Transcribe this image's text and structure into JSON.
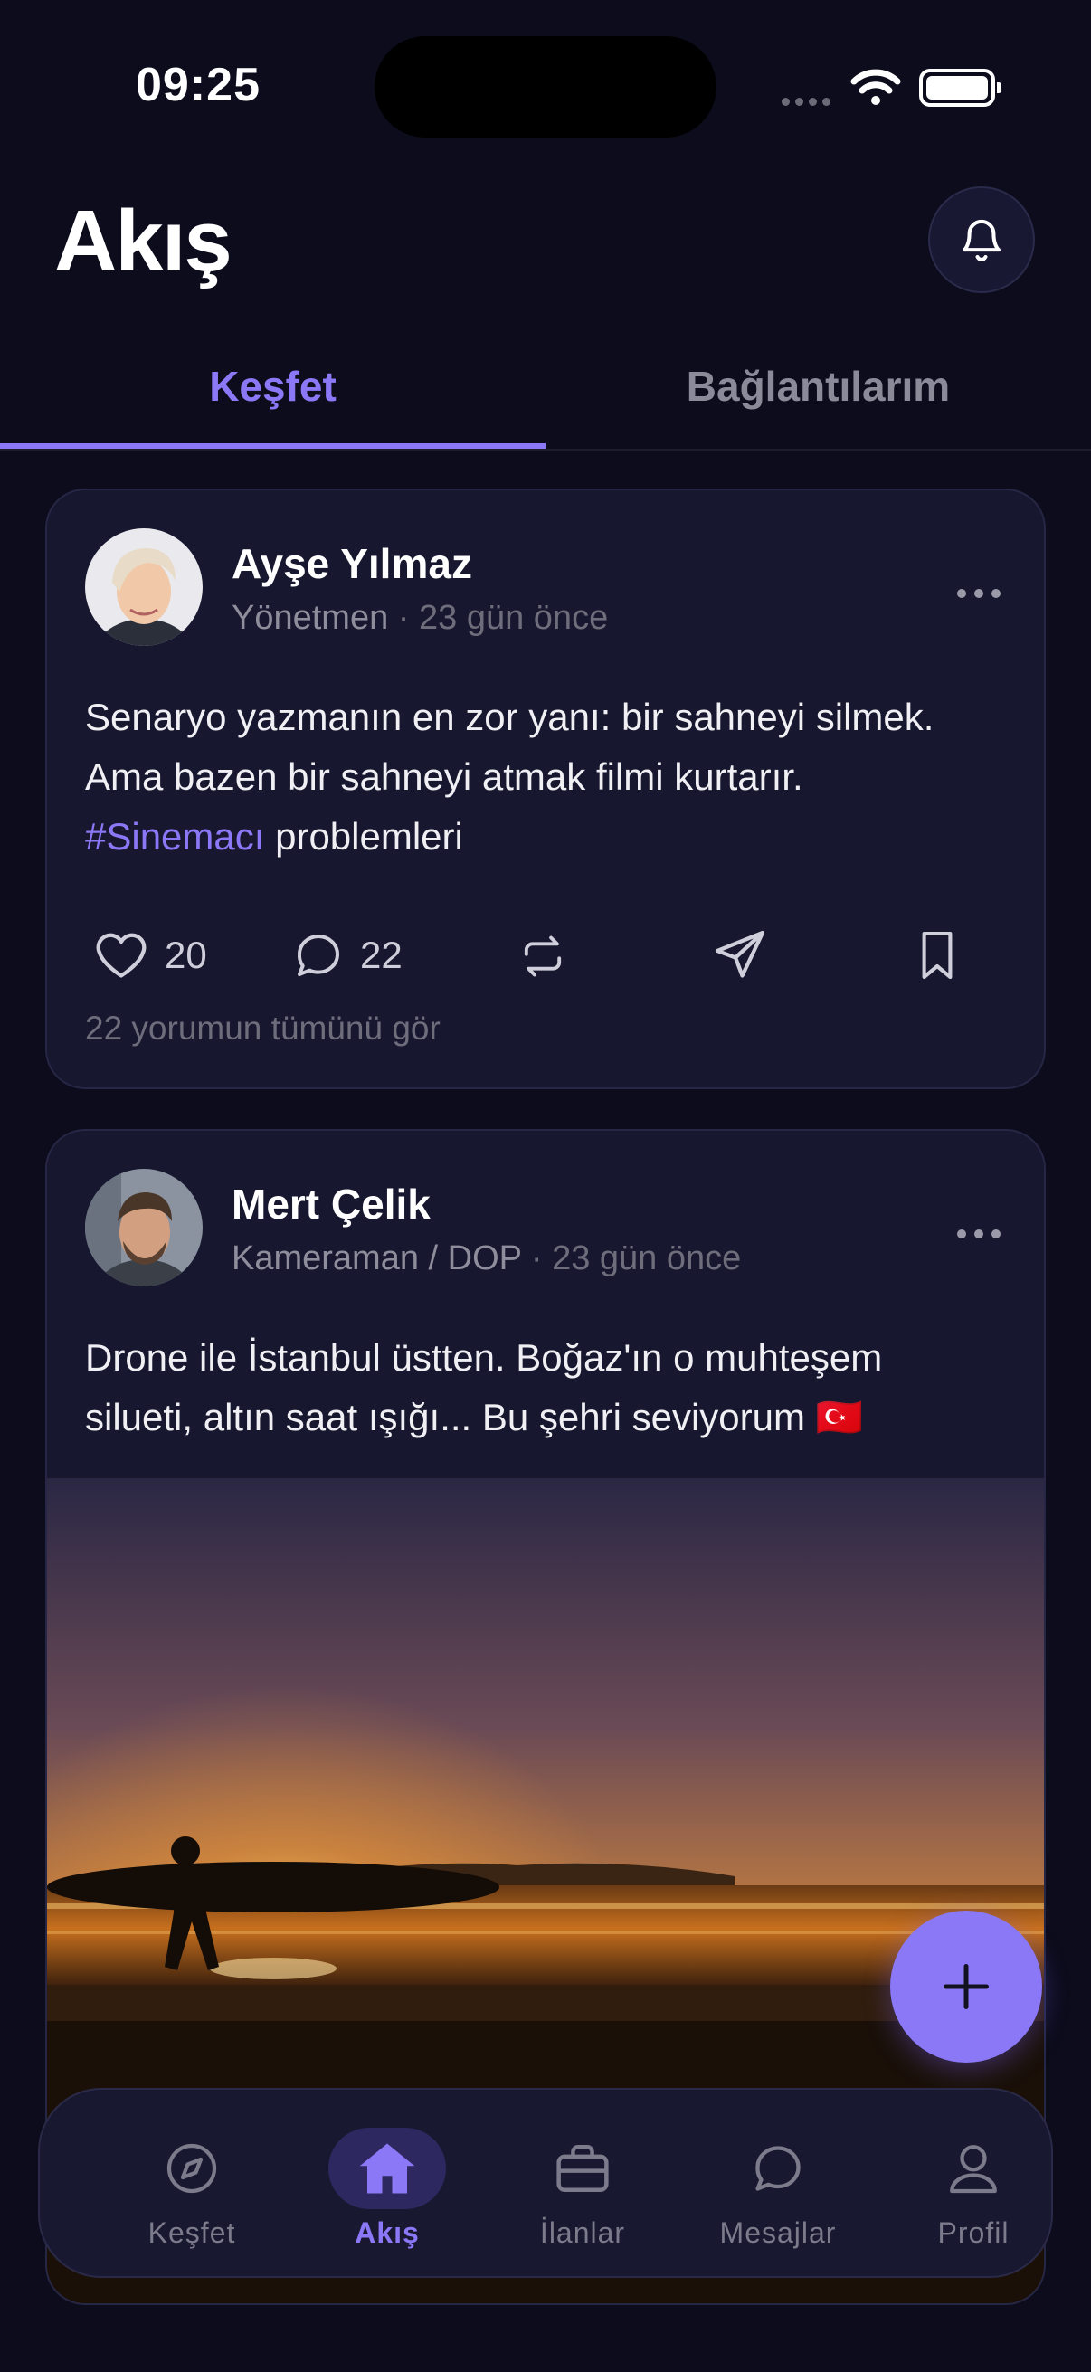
{
  "status_bar": {
    "time": "09:25"
  },
  "header": {
    "title": "Akış",
    "bell_icon": "bell-icon"
  },
  "tabs": [
    {
      "label": "Keşfet",
      "active": true
    },
    {
      "label": "Bağlantılarım",
      "active": false
    }
  ],
  "posts": [
    {
      "author": "Ayşe Yılmaz",
      "role": "Yönetmen",
      "separator": "·",
      "time": "23 gün önce",
      "text_line1": "Senaryo yazmanın en zor yanı: bir sahneyi silmek.",
      "text_line2": "Ama bazen bir sahneyi atmak filmi kurtarır.",
      "hashtag": "#Sinemacı",
      "text_after_hashtag": " problemleri",
      "likes": "20",
      "comments": "22",
      "comments_link": "22 yorumun tümünü gör"
    },
    {
      "author": "Mert Çelik",
      "role": "Kameraman / DOP",
      "separator": "·",
      "time": "23 gün önce",
      "text_line1": "Drone ile İstanbul üstten. Boğaz'ın o muhteşem",
      "text_line2": "silueti, altın saat ışığı... Bu şehri seviyorum 🇹🇷"
    }
  ],
  "bottom_nav": [
    {
      "label": "Keşfet",
      "icon": "compass-icon",
      "active": false
    },
    {
      "label": "Akış",
      "icon": "home-icon",
      "active": true
    },
    {
      "label": "İlanlar",
      "icon": "briefcase-icon",
      "active": false
    },
    {
      "label": "Mesajlar",
      "icon": "chat-icon",
      "active": false
    },
    {
      "label": "Profil",
      "icon": "user-icon",
      "active": false
    }
  ],
  "colors": {
    "background": "#0c0c1c",
    "card": "#17172f",
    "accent": "#8b78f6",
    "muted_text": "#8d8d9c"
  }
}
